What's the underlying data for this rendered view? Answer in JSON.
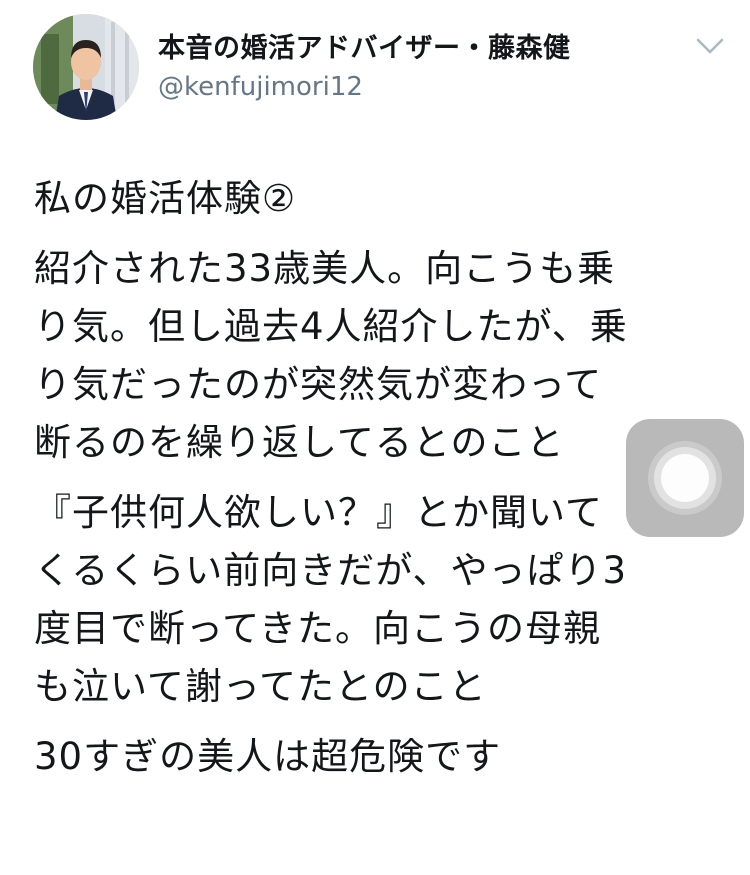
{
  "tweet": {
    "author": {
      "display_name": "本音の婚活アドバイザー・藤森健",
      "handle": "@kenfujimori12",
      "avatar_icon": "profile-photo"
    },
    "menu_icon": "chevron-down-icon",
    "paragraphs": [
      "私の婚活体験②",
      "紹介された33歳美人。向こうも乗\nり気。但し過去4人紹介したが、乗\nり気だったのが突然気が変わって\n断るのを繰り返してるとのこと",
      "『子供何人欲しい？』とか聞いて\nくるくらい前向きだが、やっぱり3\n度目で断ってきた。向こうの母親\nも泣いて謝ってたとのこと",
      "30すぎの美人は超危険です"
    ]
  },
  "overlay": {
    "assistive_touch_icon": "assistive-touch-icon"
  },
  "colors": {
    "text_primary": "#14171a",
    "text_secondary": "#657786",
    "overlay_bg": "#808080"
  }
}
